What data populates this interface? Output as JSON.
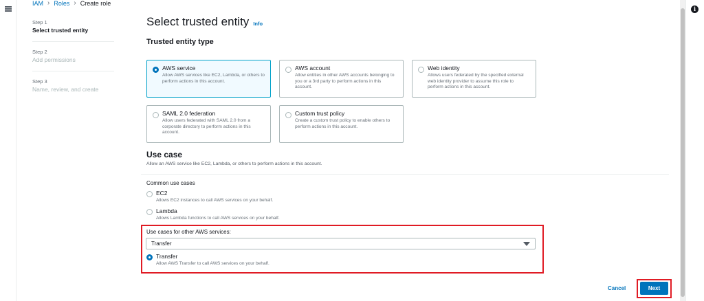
{
  "breadcrumb": {
    "item1": "IAM",
    "item2": "Roles",
    "item3": "Create role"
  },
  "steps": [
    {
      "num": "Step 1",
      "label": "Select trusted entity"
    },
    {
      "num": "Step 2",
      "label": "Add permissions"
    },
    {
      "num": "Step 3",
      "label": "Name, review, and create"
    }
  ],
  "page": {
    "title": "Select trusted entity",
    "info": "Info"
  },
  "entity": {
    "heading": "Trusted entity type",
    "tiles": [
      {
        "title": "AWS service",
        "desc": "Allow AWS services like EC2, Lambda, or others to perform actions in this account."
      },
      {
        "title": "AWS account",
        "desc": "Allow entities in other AWS accounts belonging to you or a 3rd party to perform actions in this account."
      },
      {
        "title": "Web identity",
        "desc": "Allows users federated by the specified external web identity provider to assume this role to perform actions in this account."
      },
      {
        "title": "SAML 2.0 federation",
        "desc": "Allow users federated with SAML 2.0 from a corporate directory to perform actions in this account."
      },
      {
        "title": "Custom trust policy",
        "desc": "Create a custom trust policy to enable others to perform actions in this account."
      }
    ]
  },
  "usecase": {
    "heading": "Use case",
    "desc": "Allow an AWS service like EC2, Lambda, or others to perform actions in this account.",
    "common_label": "Common use cases",
    "options": [
      {
        "title": "EC2",
        "desc": "Allows EC2 instances to call AWS services on your behalf."
      },
      {
        "title": "Lambda",
        "desc": "Allows Lambda functions to call AWS services on your behalf."
      }
    ],
    "other_label": "Use cases for other AWS services:",
    "select_value": "Transfer",
    "selected_option": {
      "title": "Transfer",
      "desc": "Allow AWS Transfer to call AWS services on your behalf."
    }
  },
  "footer": {
    "cancel": "Cancel",
    "next": "Next"
  },
  "icons": {
    "menu": "hamburger-icon",
    "info": "info-icon",
    "caret": "caret-down-icon"
  },
  "colors": {
    "accent": "#0073bb",
    "highlight": "#e01b24",
    "selected_bg": "#f1faff"
  }
}
